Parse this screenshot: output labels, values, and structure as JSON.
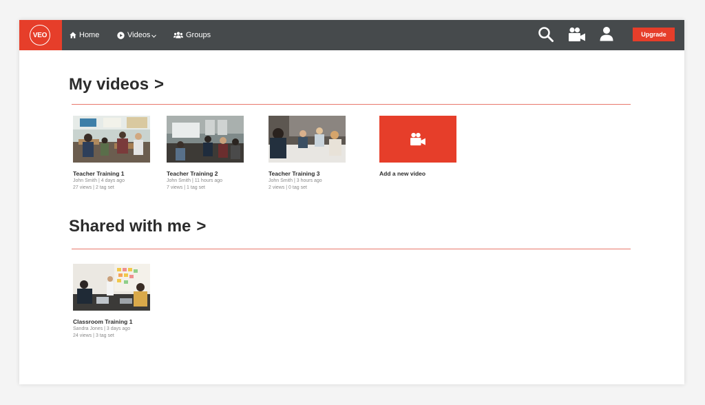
{
  "app": {
    "logo_text": "VEO"
  },
  "nav": {
    "home_label": "Home",
    "videos_label": "Videos",
    "groups_label": "Groups",
    "upgrade_label": "Upgrade"
  },
  "icons": {
    "logo": "veo-logo",
    "home": "home-icon",
    "videos": "play-circle-icon",
    "videos_dropdown": "chevron-down-icon",
    "groups": "group-icon",
    "search": "search-icon",
    "record": "video-camera-icon",
    "profile": "user-icon",
    "add_video": "video-camera-icon"
  },
  "colors": {
    "accent": "#e63e2a",
    "topbar": "#464a4c",
    "divider": "#e8776a",
    "text": "#2c2c2c",
    "meta_text": "#8a8a8a"
  },
  "my_videos": {
    "title": "My videos",
    "arrow": ">",
    "items": [
      {
        "title": "Teacher Training 1",
        "meta1": "John Smith | 4 days ago",
        "meta2": "27 views | 2 tag set"
      },
      {
        "title": "Teacher Training 2",
        "meta1": "John Smith | 11 hours ago",
        "meta2": "7 views | 1 tag set"
      },
      {
        "title": "Teacher Training 3",
        "meta1": "John Smith | 3 hours ago",
        "meta2": "2 views | 0 tag set"
      }
    ],
    "add_label": "Add a new video"
  },
  "shared": {
    "title": "Shared with me",
    "arrow": ">",
    "items": [
      {
        "title": "Classroom Training 1",
        "meta1": "Sandra Jones | 3 days ago",
        "meta2": "24 views | 3 tag set"
      }
    ]
  }
}
